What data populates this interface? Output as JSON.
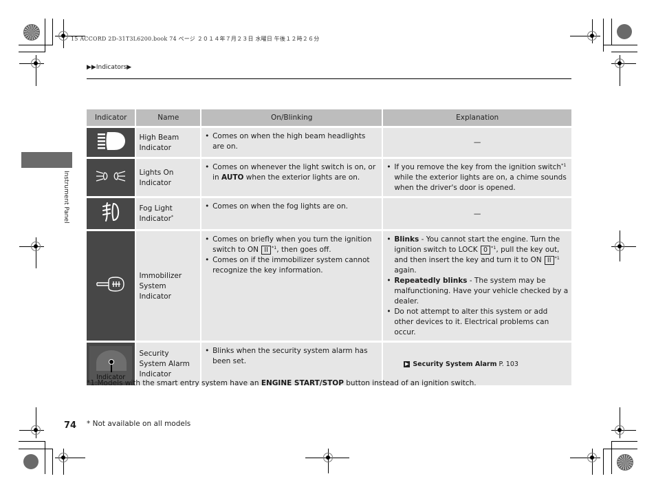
{
  "print_header": {
    "file_line": "15 ACCORD 2D-31T3L6200.book  74 ページ  ２０１４年７月２３日  水曜日  午後１２時２６分"
  },
  "breadcrumb": "▶▶Indicators▶",
  "side_tab": {
    "label": "Instrument Panel"
  },
  "table": {
    "headers": [
      "Indicator",
      "Name",
      "On/Blinking",
      "Explanation"
    ],
    "rows": [
      {
        "icon": "high-beam-icon",
        "name": "High Beam Indicator",
        "on_blinking": [
          "Comes on when the high beam headlights are on."
        ],
        "explanation": "—"
      },
      {
        "icon": "lights-on-icon",
        "name": "Lights On Indicator",
        "on_blinking_pre": "Comes on whenever the light switch is on, or in ",
        "on_blinking_bold": "AUTO",
        "on_blinking_post": " when the exterior lights are on.",
        "explanation": "If you remove the key from the ignition switch",
        "explanation_sup": "*1",
        "explanation_post": " while the exterior lights are on, a chime sounds when the driver's door is opened."
      },
      {
        "icon": "fog-light-icon",
        "name": "Fog Light Indicator",
        "name_sup": "*",
        "on_blinking": [
          "Comes on when the fog lights are on."
        ],
        "explanation": "—"
      },
      {
        "icon": "immobilizer-key-icon",
        "name": "Immobilizer System Indicator",
        "on_blinking_1_pre": "Comes on briefly when you turn the ignition switch to ON ",
        "on_blinking_1_key": "II",
        "on_blinking_1_sup": "*1",
        "on_blinking_1_post": ", then goes off.",
        "on_blinking_2": "Comes on if the immobilizer system cannot recognize the key information.",
        "exp_1_bold": "Blinks",
        "exp_1_a": " - You cannot start the engine. Turn the ignition switch to LOCK ",
        "exp_1_key1": "0",
        "exp_1_sup1": "*1",
        "exp_1_b": ", pull the key out, and then insert the key and turn it to ON ",
        "exp_1_key2": "II",
        "exp_1_sup2": "*1",
        "exp_1_c": " again.",
        "exp_2_bold": "Repeatedly blinks",
        "exp_2": " - The system may be malfunctioning. Have your vehicle checked by a dealer.",
        "exp_3": "Do not attempt to alter this system or add other devices to it. Electrical problems can occur."
      },
      {
        "icon": "security-alarm-gauge-image",
        "icon_label": "Indicator",
        "name": "Security System Alarm Indicator",
        "on_blinking": [
          "Blinks when the security system alarm has been set."
        ],
        "ref_arrow": "▶",
        "ref_title": "Security System Alarm",
        "ref_page": " P. 103"
      }
    ]
  },
  "footnote_1": {
    "pre": "*1:Models with the smart entry system have an ",
    "bold": "ENGINE START/STOP",
    "post": " button instead of an ignition switch."
  },
  "page_number": "74",
  "not_available_note": "* Not available on all models"
}
